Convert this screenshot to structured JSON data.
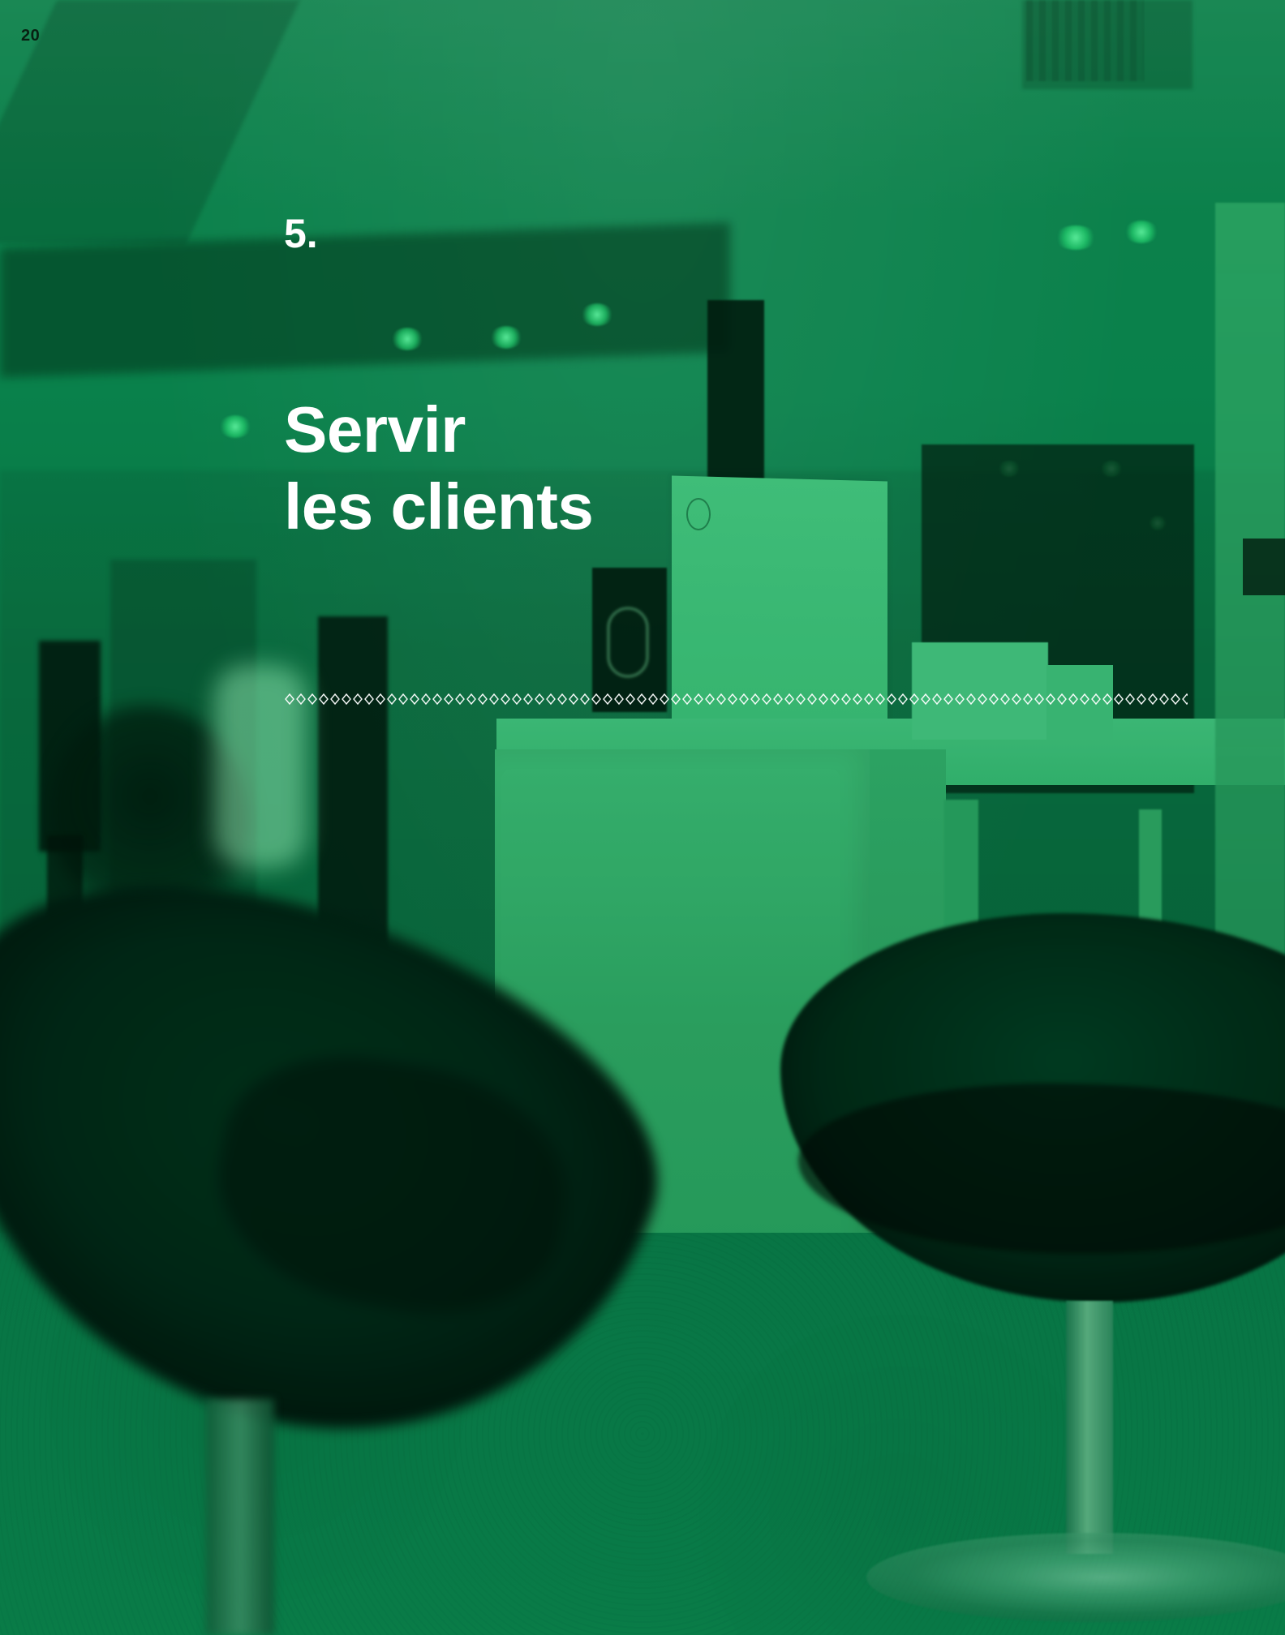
{
  "page": {
    "number": "20"
  },
  "section": {
    "number": "5.",
    "title_line_1": "Servir",
    "title_line_2": "les clients"
  },
  "colors": {
    "background_green": "#007b48",
    "text_white": "#ffffff",
    "page_number_dark": "#082012"
  }
}
